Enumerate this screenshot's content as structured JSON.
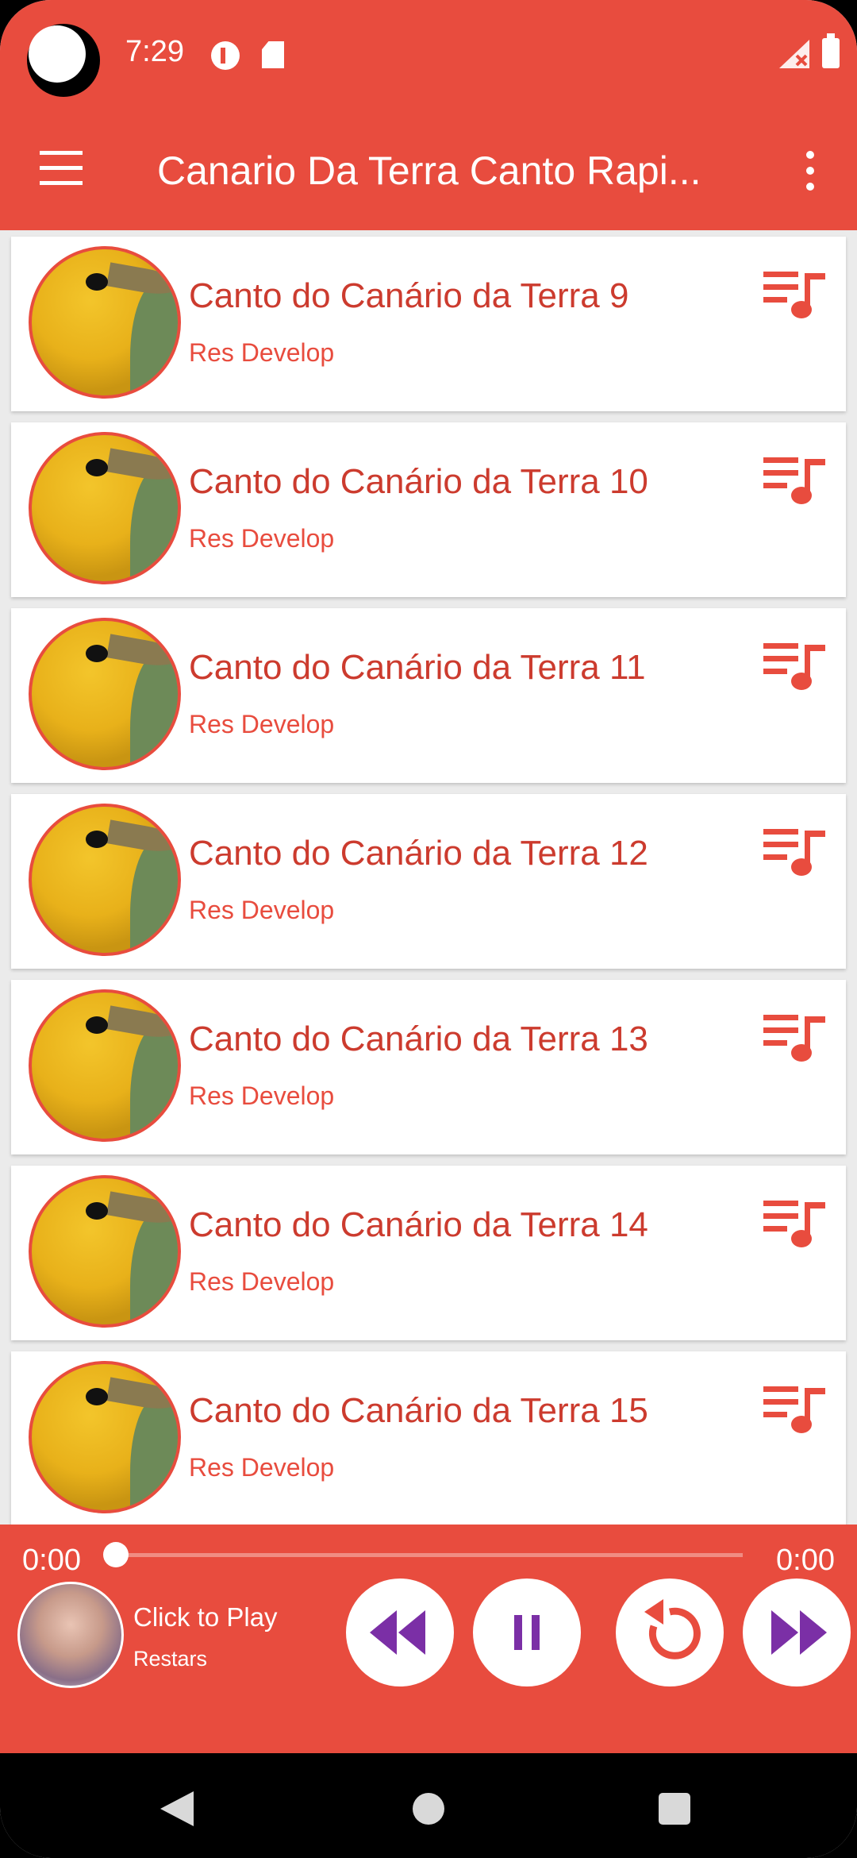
{
  "status_bar": {
    "time": "7:29",
    "icons": [
      "camera-cutout",
      "p-notification-icon",
      "sd-card-icon",
      "signal-icon",
      "battery-icon"
    ]
  },
  "app_bar": {
    "title": "Canario Da Terra Canto Rapi...",
    "icons": [
      "menu-icon",
      "more-vert-icon"
    ]
  },
  "songs": [
    {
      "title": "Canto do Canário da Terra 9",
      "artist": "Res Develop",
      "action_icon": "playlist-icon"
    },
    {
      "title": "Canto do Canário da Terra 10",
      "artist": "Res Develop",
      "action_icon": "playlist-icon"
    },
    {
      "title": "Canto do Canário da Terra 11",
      "artist": "Res Develop",
      "action_icon": "playlist-icon"
    },
    {
      "title": "Canto do Canário da Terra 12",
      "artist": "Res Develop",
      "action_icon": "playlist-icon"
    },
    {
      "title": "Canto do Canário da Terra 13",
      "artist": "Res Develop",
      "action_icon": "playlist-icon"
    },
    {
      "title": "Canto do Canário da Terra 14",
      "artist": "Res Develop",
      "action_icon": "playlist-icon"
    },
    {
      "title": "Canto do Canário da Terra 15",
      "artist": "Res Develop",
      "action_icon": "playlist-icon"
    }
  ],
  "player": {
    "time_elapsed": "0:00",
    "time_total": "0:00",
    "progress": 0,
    "now_playing_title": "Click to Play",
    "now_playing_subtitle": "Restars",
    "controls": [
      "rewind-icon",
      "pause-icon",
      "replay-icon",
      "fast-forward-icon"
    ]
  },
  "colors": {
    "primary": "#e84c3e",
    "title_text": "#cc3b2e",
    "control_icon": "#7b2fa6",
    "card_bg": "#ffffff"
  }
}
